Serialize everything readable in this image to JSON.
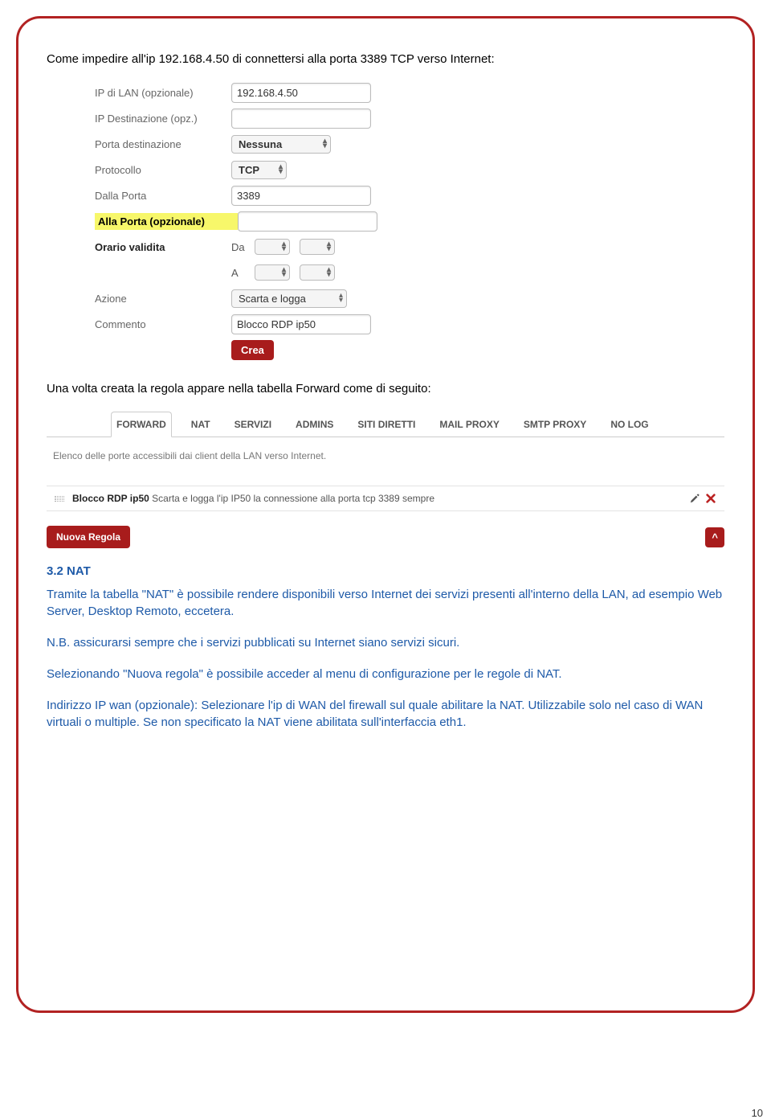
{
  "intro_text": "Come impedire all'ip 192.168.4.50 di connettersi alla porta 3389 TCP verso Internet:",
  "form": {
    "labels": {
      "lan_ip": "IP di LAN (opzionale)",
      "dest_ip": "IP Destinazione (opz.)",
      "dest_port": "Porta destinazione",
      "protocol": "Protocollo",
      "from_port": "Dalla Porta",
      "to_port": "Alla Porta (opzionale)",
      "validity": "Orario validita",
      "da": "Da",
      "a": "A",
      "action": "Azione",
      "comment": "Commento"
    },
    "values": {
      "lan_ip": "192.168.4.50",
      "dest_ip": "",
      "dest_port_select": "Nessuna",
      "protocol_select": "TCP",
      "from_port": "3389",
      "to_port": "",
      "action_select": "Scarta e logga",
      "comment": "Blocco RDP ip50"
    },
    "button_crea": "Crea"
  },
  "after_form_text": "Una volta creata la regola appare nella tabella Forward come di seguito:",
  "tabs": {
    "items": [
      "FORWARD",
      "NAT",
      "SERVIZI",
      "ADMINS",
      "SITI DIRETTI",
      "MAIL PROXY",
      "SMTP PROXY",
      "NO LOG"
    ],
    "desc": "Elenco delle porte accessibili dai client della LAN verso Internet.",
    "rule_name": "Blocco RDP ip50",
    "rule_rest": " Scarta e logga l'ip IP50 la connessione alla porta tcp 3389 sempre",
    "button_nuova": "Nuova Regola"
  },
  "section": {
    "heading": "3.2 NAT",
    "p1": "Tramite la tabella \"NAT\" è possibile rendere disponibili verso Internet dei servizi presenti all'interno della LAN, ad esempio Web Server, Desktop Remoto, eccetera.",
    "p2": "N.B. assicurarsi sempre che i servizi pubblicati su Internet siano servizi sicuri.",
    "p3": "Selezionando \"Nuova regola\" è possibile acceder al menu di configurazione per le regole di NAT.",
    "p4": "Indirizzo IP wan (opzionale): Selezionare l'ip di WAN del firewall sul quale abilitare la NAT. Utilizzabile solo nel caso di WAN virtuali o multiple. Se non specificato la NAT viene abilitata sull'interfaccia eth1."
  },
  "page_number": "10"
}
